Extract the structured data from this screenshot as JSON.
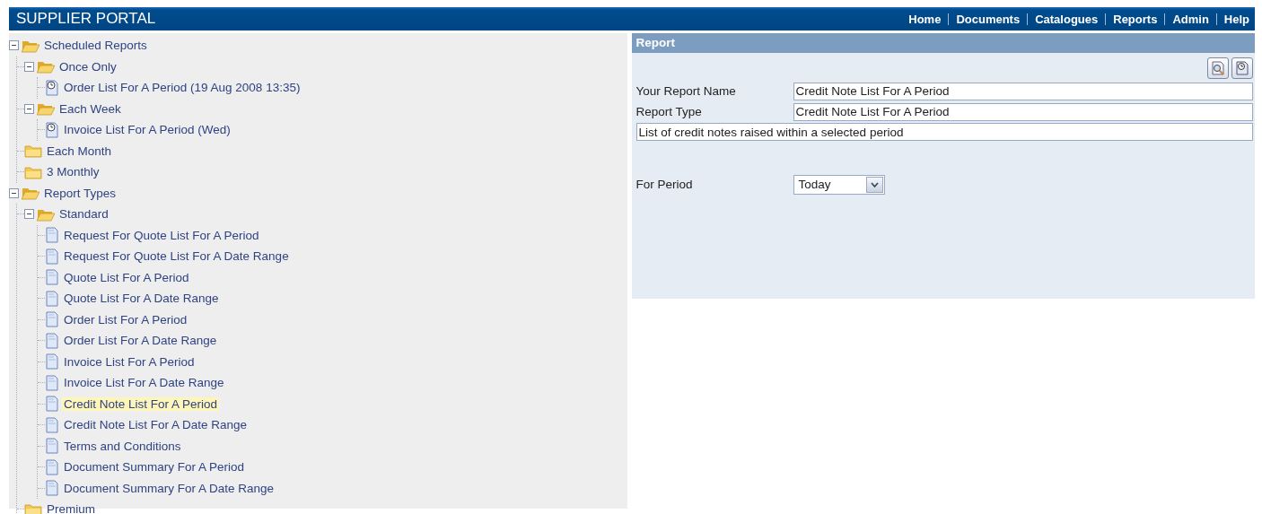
{
  "header": {
    "title": "SUPPLIER PORTAL",
    "nav": [
      {
        "label": "Home"
      },
      {
        "label": "Documents"
      },
      {
        "label": "Catalogues"
      },
      {
        "label": "Reports"
      },
      {
        "label": "Admin"
      },
      {
        "label": "Help"
      }
    ]
  },
  "tree": [
    {
      "kind": "folder",
      "label": "Scheduled Reports",
      "expanded": true,
      "children": [
        {
          "kind": "folder",
          "label": "Once Only",
          "expanded": true,
          "children": [
            {
              "kind": "scheduled",
              "label": "Order List For A Period (19 Aug 2008 13:35)",
              "selected": false
            }
          ]
        },
        {
          "kind": "folder",
          "label": "Each Week",
          "expanded": true,
          "children": [
            {
              "kind": "scheduled",
              "label": "Invoice List For A Period (Wed)",
              "selected": false
            }
          ]
        },
        {
          "kind": "folder",
          "label": "Each Month",
          "expanded": false
        },
        {
          "kind": "folder",
          "label": "3 Monthly",
          "expanded": false
        }
      ]
    },
    {
      "kind": "folder",
      "label": "Report Types",
      "expanded": true,
      "children": [
        {
          "kind": "folder",
          "label": "Standard",
          "expanded": true,
          "children": [
            {
              "kind": "report",
              "label": "Request For Quote List For A Period",
              "selected": false
            },
            {
              "kind": "report",
              "label": "Request For Quote List For A Date Range",
              "selected": false
            },
            {
              "kind": "report",
              "label": "Quote List For A Period",
              "selected": false
            },
            {
              "kind": "report",
              "label": "Quote List For A Date Range",
              "selected": false
            },
            {
              "kind": "report",
              "label": "Order List For A Period",
              "selected": false
            },
            {
              "kind": "report",
              "label": "Order List For A Date Range",
              "selected": false
            },
            {
              "kind": "report",
              "label": "Invoice List For A Period",
              "selected": false
            },
            {
              "kind": "report",
              "label": "Invoice List For A Date Range",
              "selected": false
            },
            {
              "kind": "report",
              "label": "Credit Note List For A Period",
              "selected": true
            },
            {
              "kind": "report",
              "label": "Credit Note List For A Date Range",
              "selected": false
            },
            {
              "kind": "report",
              "label": "Terms and Conditions",
              "selected": false
            },
            {
              "kind": "report",
              "label": "Document Summary For A Period",
              "selected": false
            },
            {
              "kind": "report",
              "label": "Document Summary For A Date Range",
              "selected": false
            }
          ]
        },
        {
          "kind": "folder",
          "label": "Premium",
          "expanded": false
        }
      ]
    }
  ],
  "report": {
    "title": "Report",
    "fields": [
      {
        "label": "Your Report Name",
        "value": "Credit Note List For A Period"
      },
      {
        "label": "Report Type",
        "value": "Credit Note List For A Period"
      }
    ],
    "description": "List of credit notes raised within a selected period",
    "period": {
      "label": "For Period",
      "value": "Today"
    }
  }
}
